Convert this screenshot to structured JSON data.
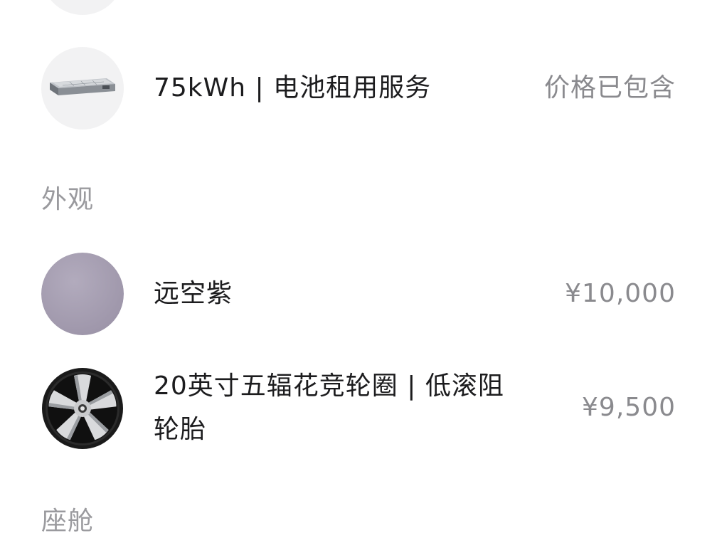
{
  "battery_item": {
    "icon": "battery-pack-icon",
    "label": "75kWh | 电池租用服务",
    "price": "价格已包含"
  },
  "exterior_section": {
    "title": "外观",
    "items": [
      {
        "icon": "color-swatch-icon",
        "swatch_color": "#a79fb2",
        "label": "远空紫",
        "price": "¥10,000"
      },
      {
        "icon": "wheel-rim-icon",
        "label_line1": "20英寸五辐花竞轮圈 | 低滚阻",
        "label_line2": "轮胎",
        "price": "¥9,500"
      }
    ]
  },
  "cabin_section": {
    "title": "座舱"
  }
}
